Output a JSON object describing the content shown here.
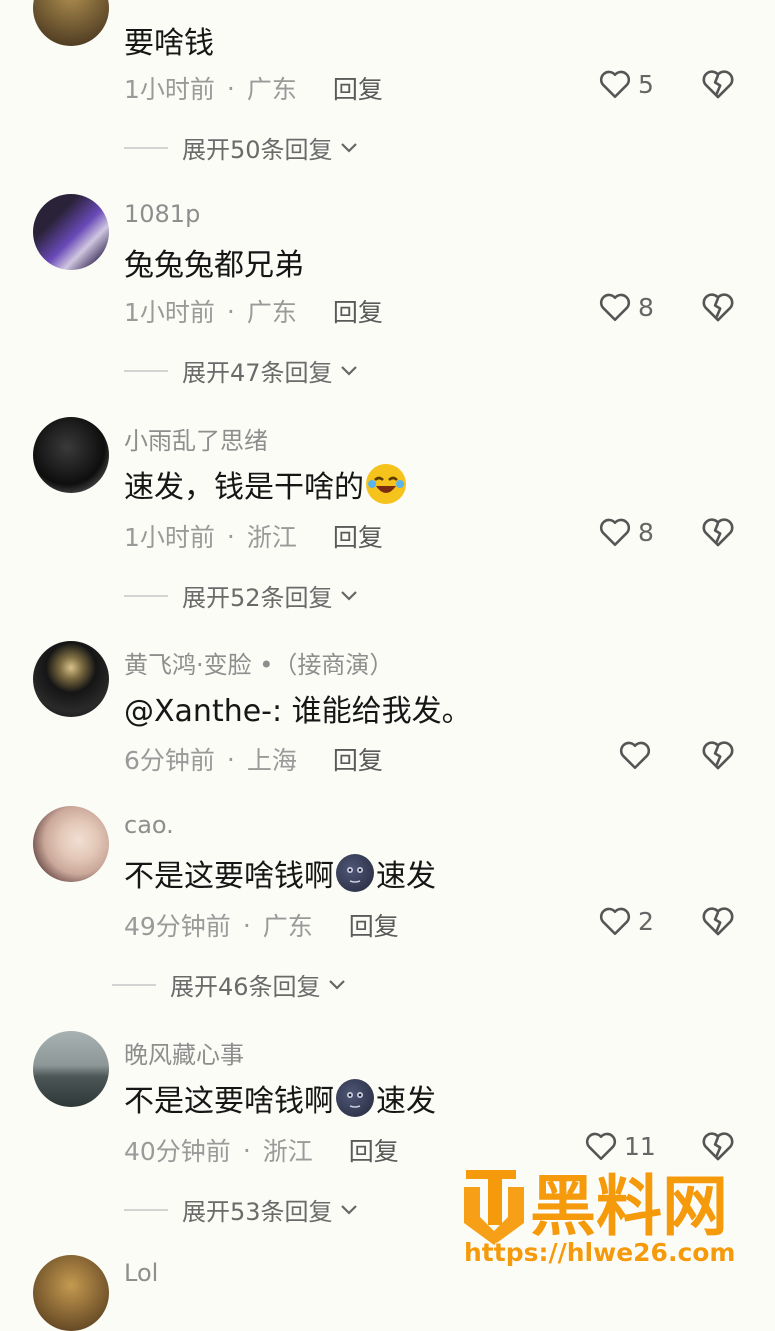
{
  "comments": [
    {
      "username": "",
      "text": "要啥钱",
      "time": "1小时前",
      "location": "广东",
      "reply": "回复",
      "likes": "5",
      "expand": "展开50条回复"
    },
    {
      "username": "1081p",
      "text": "兔兔兔都兄弟",
      "time": "1小时前",
      "location": "广东",
      "reply": "回复",
      "likes": "8",
      "expand": "展开47条回复"
    },
    {
      "username": "小雨乱了思绪",
      "text": "速发，钱是干啥的",
      "time": "1小时前",
      "location": "浙江",
      "reply": "回复",
      "likes": "8",
      "expand": "展开52条回复"
    },
    {
      "username": "黄飞鸿·变脸 •（接商演）",
      "text": "@Xanthe-: 谁能给我发。",
      "time": "6分钟前",
      "location": "上海",
      "reply": "回复",
      "likes": "",
      "expand": ""
    },
    {
      "username": "cao.",
      "text_a": "不是这要啥钱啊",
      "text_b": "速发",
      "time": "49分钟前",
      "location": "广东",
      "reply": "回复",
      "likes": "2",
      "expand": "展开46条回复"
    },
    {
      "username": "晚风藏心事",
      "text_a": "不是这要啥钱啊",
      "text_b": "速发",
      "time": "40分钟前",
      "location": "浙江",
      "reply": "回复",
      "likes": "11",
      "expand": "展开53条回复"
    },
    {
      "username": "Lol"
    }
  ],
  "watermark": {
    "brand": "黑料网",
    "url": "https://hlwe26.com"
  },
  "icons": {
    "like": "heart-outline-icon",
    "dislike": "broken-heart-icon",
    "expand": "chevron-down-icon"
  },
  "colors": {
    "background": "#fbfcf6",
    "watermark": "#f59a0b"
  }
}
